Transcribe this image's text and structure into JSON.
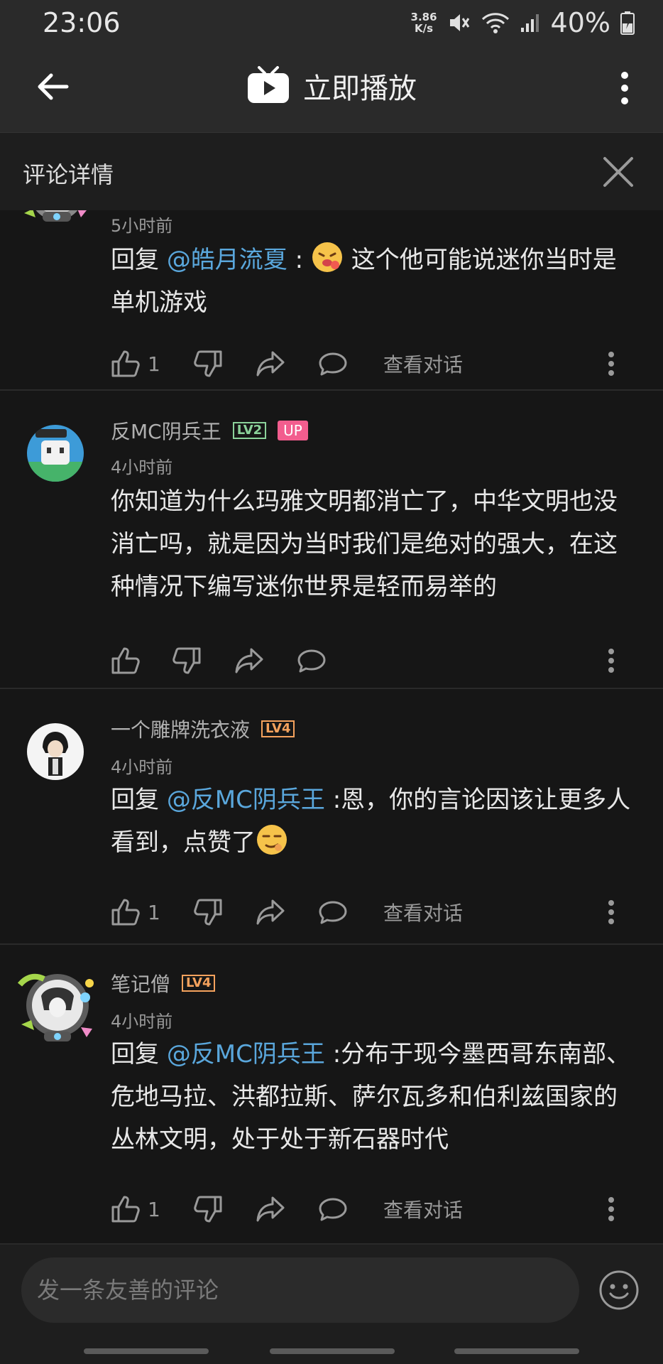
{
  "status_bar": {
    "time": "23:06",
    "net_speed_value": "3.86",
    "net_speed_unit": "K/s",
    "battery": "40%"
  },
  "app_bar": {
    "title": "立即播放"
  },
  "panel": {
    "title": "评论详情"
  },
  "comments": [
    {
      "timestamp_partial": "5小时前",
      "reply_prefix": "回复 ",
      "mention": "@皓月流夏",
      "text_after": " : ",
      "text_rest": " 这个他可能说迷你当时是单机游戏",
      "likes": "1",
      "view_conversation": "查看对话"
    },
    {
      "username": "反MC阴兵王",
      "level": "LV2",
      "up_badge": "UP",
      "timestamp": "4小时前",
      "text": "你知道为什么玛雅文明都消亡了，中华文明也没消亡吗，就是因为当时我们是绝对的强大，在这种情况下编写迷你世界是轻而易举的"
    },
    {
      "username": "一个雕牌洗衣液",
      "level": "LV4",
      "timestamp": "4小时前",
      "reply_prefix": "回复 ",
      "mention": "@反MC阴兵王",
      "text_after": " :恩，你的言论因该让更多人看到，点赞了",
      "likes": "1",
      "view_conversation": "查看对话"
    },
    {
      "username": "笔记僧",
      "level": "LV4",
      "timestamp": "4小时前",
      "reply_prefix": "回复 ",
      "mention": "@反MC阴兵王",
      "text_after": " :分布于现今墨西哥东南部、危地马拉、洪都拉斯、萨尔瓦多和伯利兹国家的丛林文明，处于处于新石器时代",
      "likes": "1",
      "view_conversation": "查看对话"
    }
  ],
  "footer": {
    "placeholder": "发一条友善的评论"
  },
  "colors": {
    "background": "#161616",
    "mention": "#5aa7dc",
    "level_2": "#8bd29a",
    "level_4": "#f5a25d",
    "up_badge": "#f25d8e"
  }
}
